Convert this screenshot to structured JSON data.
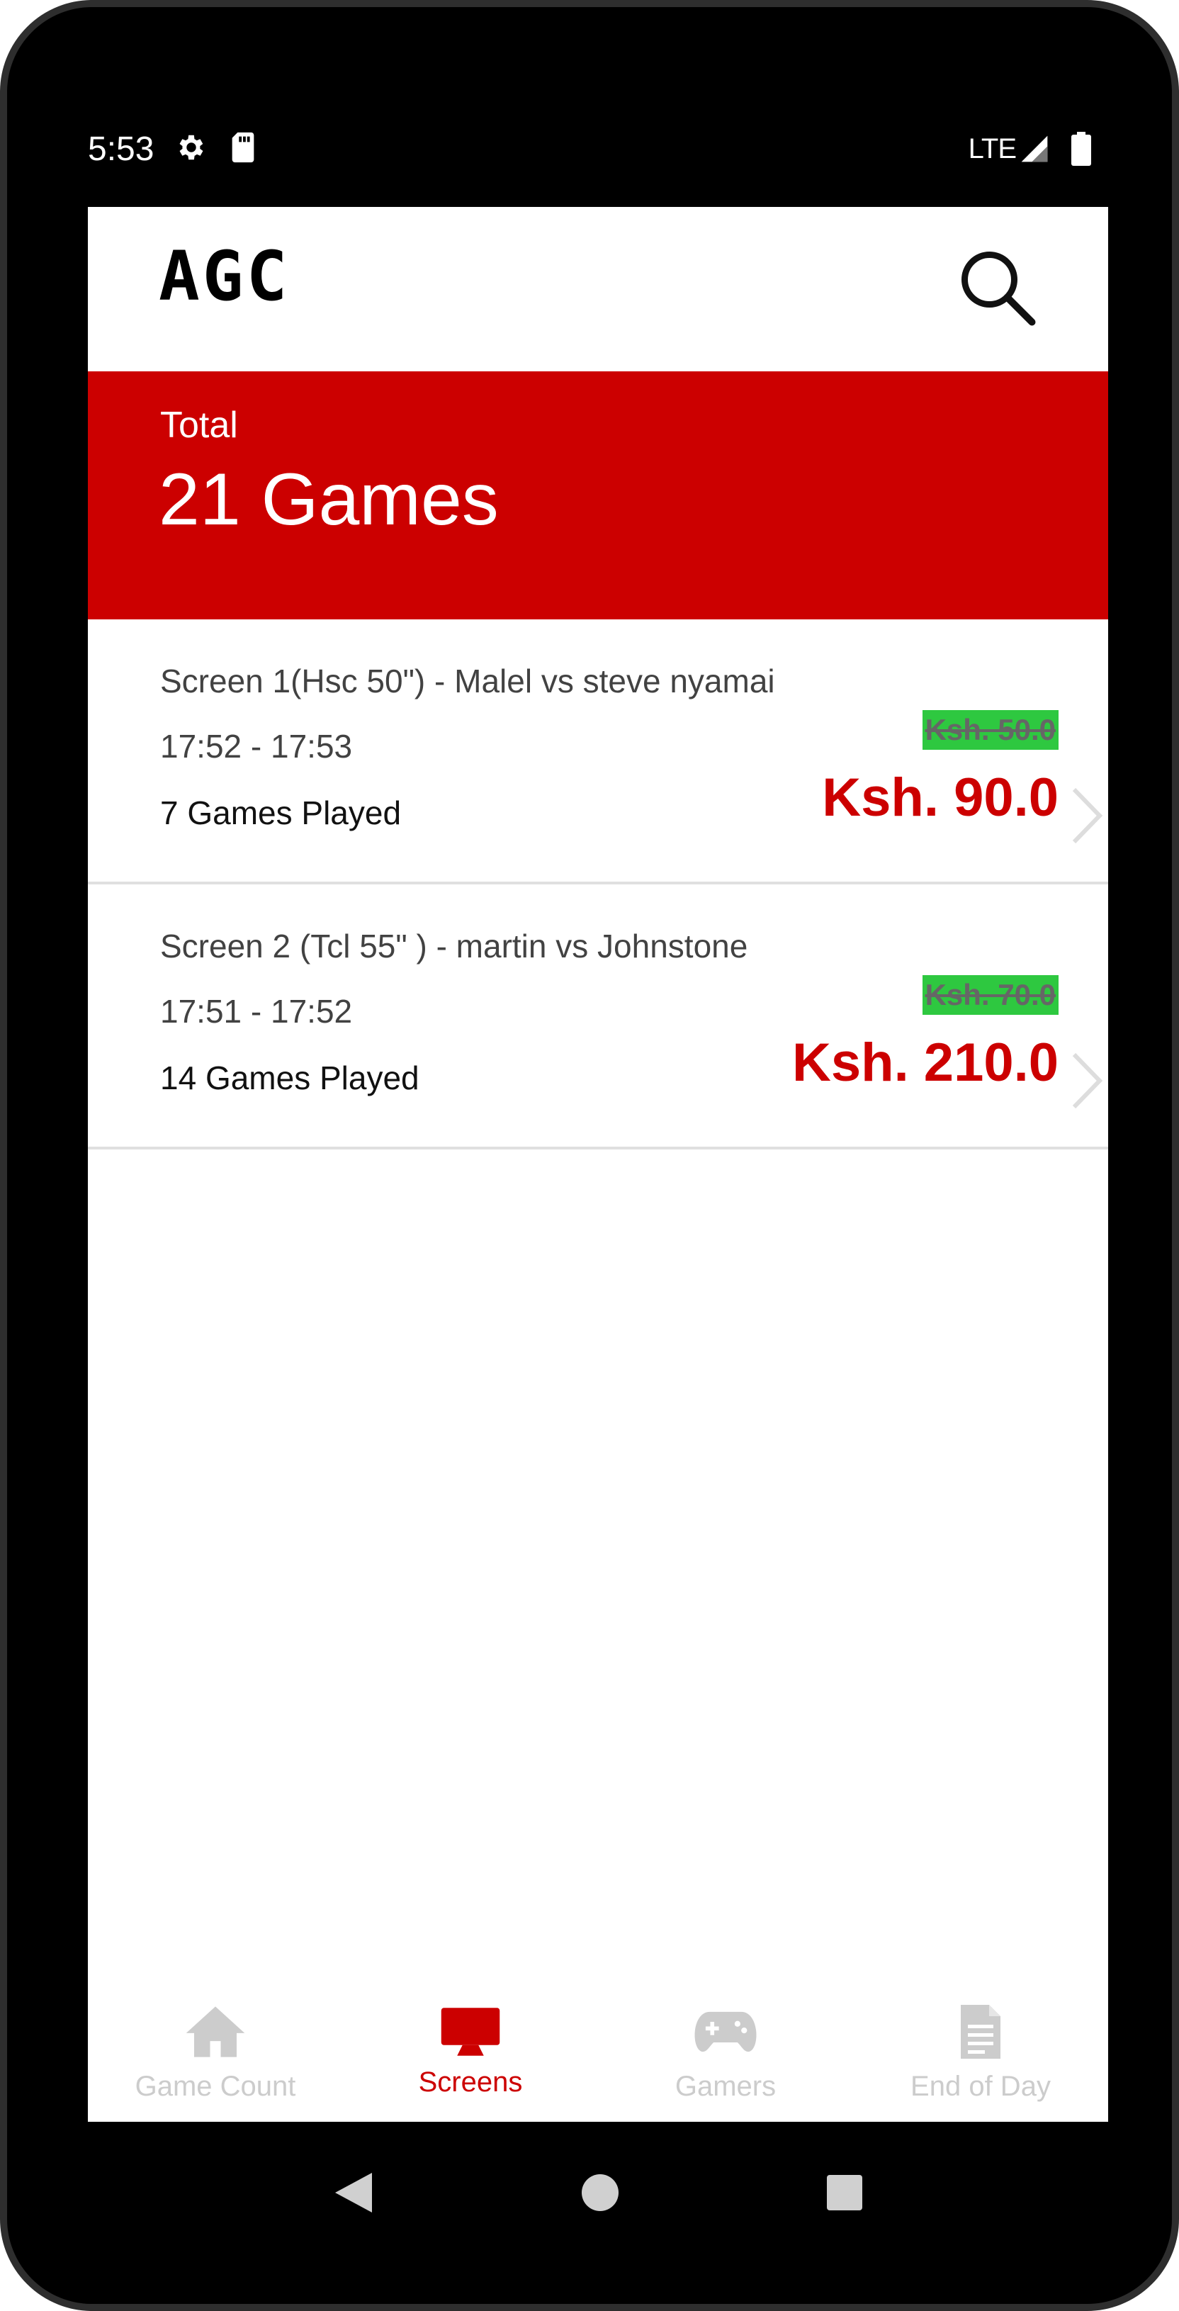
{
  "status_bar": {
    "time": "5:53",
    "network": "LTE",
    "icons": [
      "gear-icon",
      "sd-card-icon",
      "signal-icon",
      "battery-icon"
    ]
  },
  "app_bar": {
    "logo": "AGC",
    "search_icon": "search-icon"
  },
  "summary": {
    "label": "Total",
    "value": "21 Games"
  },
  "sessions": [
    {
      "title": "Screen 1(Hsc 50\") - Malel vs steve nyamai",
      "time": "17:52 - 17:53",
      "games": "7 Games Played",
      "rate": "Ksh. 50.0",
      "amount": "Ksh. 90.0"
    },
    {
      "title": "Screen 2 (Tcl 55\" ) - martin vs Johnstone",
      "time": "17:51 - 17:52",
      "games": "14 Games Played",
      "rate": "Ksh. 70.0",
      "amount": "Ksh. 210.0"
    }
  ],
  "bottom_nav": {
    "items": [
      {
        "label": "Game Count",
        "icon": "home-icon",
        "active": false
      },
      {
        "label": "Screens",
        "icon": "monitor-icon",
        "active": true
      },
      {
        "label": "Gamers",
        "icon": "gamepad-icon",
        "active": false
      },
      {
        "label": "End of Day",
        "icon": "document-icon",
        "active": false
      }
    ]
  },
  "colors": {
    "primary": "#cc0000",
    "rate_badge": "#2ec840",
    "inactive": "#cccccc"
  }
}
